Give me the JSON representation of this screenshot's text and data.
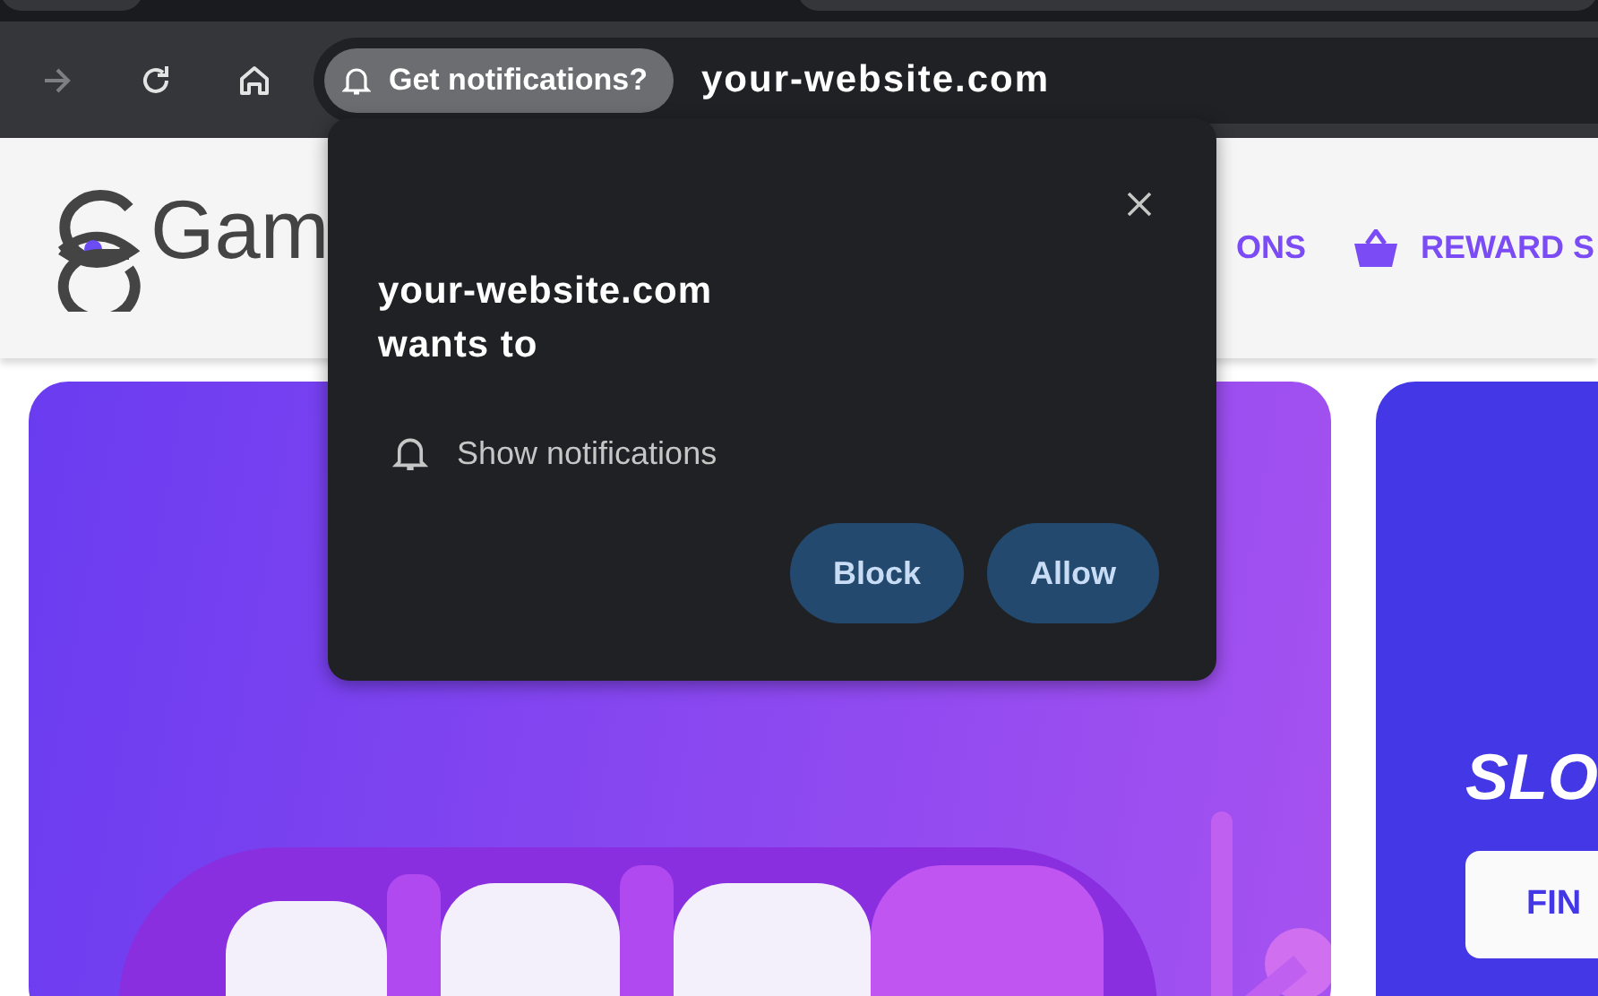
{
  "browser": {
    "nav_buttons": [
      {
        "kind": "forward",
        "disabled": true
      },
      {
        "kind": "reload",
        "disabled": false
      },
      {
        "kind": "home",
        "disabled": false
      }
    ],
    "permission_chip": {
      "label": "Get notifications?"
    },
    "url": "your-website.com"
  },
  "site": {
    "logo_text": "Gam",
    "nav": [
      {
        "label": "ONS"
      },
      {
        "label": "REWARD S"
      }
    ]
  },
  "promo_card": {
    "title": "SLO",
    "button": "FIN"
  },
  "popup": {
    "title": "your-website.com wants to",
    "permission": "Show notifications",
    "buttons": [
      "Block",
      "Allow"
    ]
  }
}
